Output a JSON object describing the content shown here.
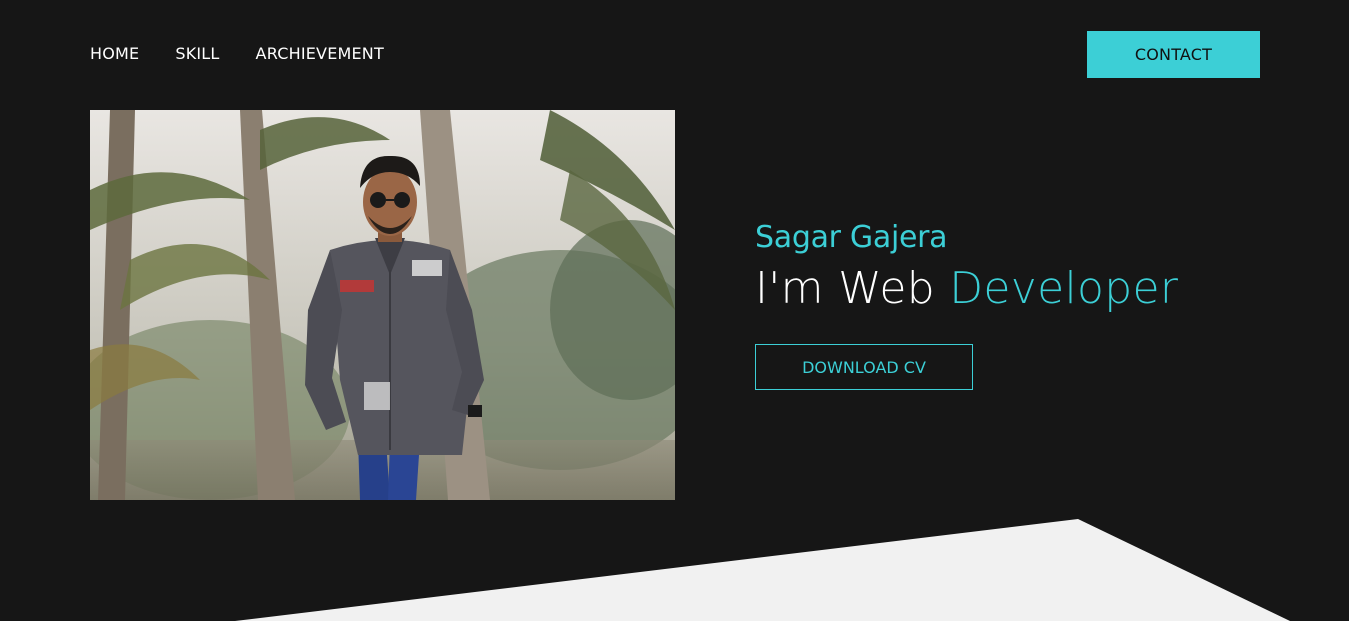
{
  "nav": {
    "items": [
      {
        "label": "HOME"
      },
      {
        "label": "SKILL"
      },
      {
        "label": "ARCHIEVEMENT"
      }
    ],
    "contact_label": "CONTACT"
  },
  "hero": {
    "name": "Sagar Gajera",
    "headline_prefix": "I'm Web",
    "headline_accent": "Developer",
    "download_label": "DOWNLOAD CV"
  },
  "colors": {
    "background": "#161616",
    "accent": "#3ccfd6",
    "text": "#ffffff",
    "wedge": "#f1f1f1"
  }
}
